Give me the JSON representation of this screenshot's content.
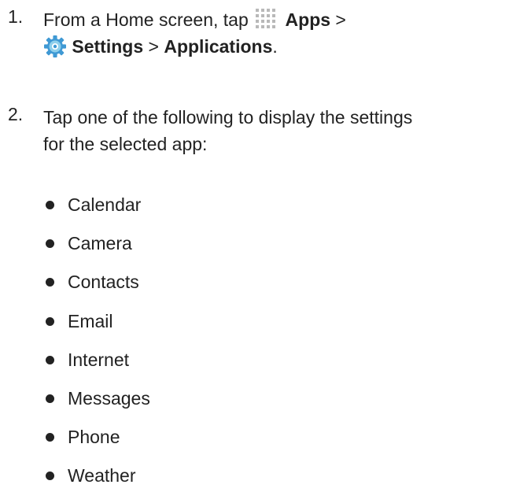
{
  "steps": [
    {
      "number": "1.",
      "text_before_apps_icon": "From a Home screen, tap ",
      "apps_label": "Apps",
      "separator_1": " >",
      "settings_label": "Settings",
      "separator_2": " > ",
      "applications_label": "Applications",
      "period": ".",
      "icons": [
        "apps-grid-icon",
        "settings-gear-icon"
      ]
    },
    {
      "number": "2.",
      "line1": "Tap one of the following to display the settings",
      "line2": "for the selected app:"
    }
  ],
  "apps": [
    "Calendar",
    "Camera",
    "Contacts",
    "Email",
    "Internet",
    "Messages",
    "Phone",
    "Weather"
  ],
  "colors": {
    "text": "#222222",
    "apps_icon": "#b9b9b9",
    "settings_icon_outer": "#3f99d4",
    "settings_icon_inner": "#8fd0ec"
  }
}
